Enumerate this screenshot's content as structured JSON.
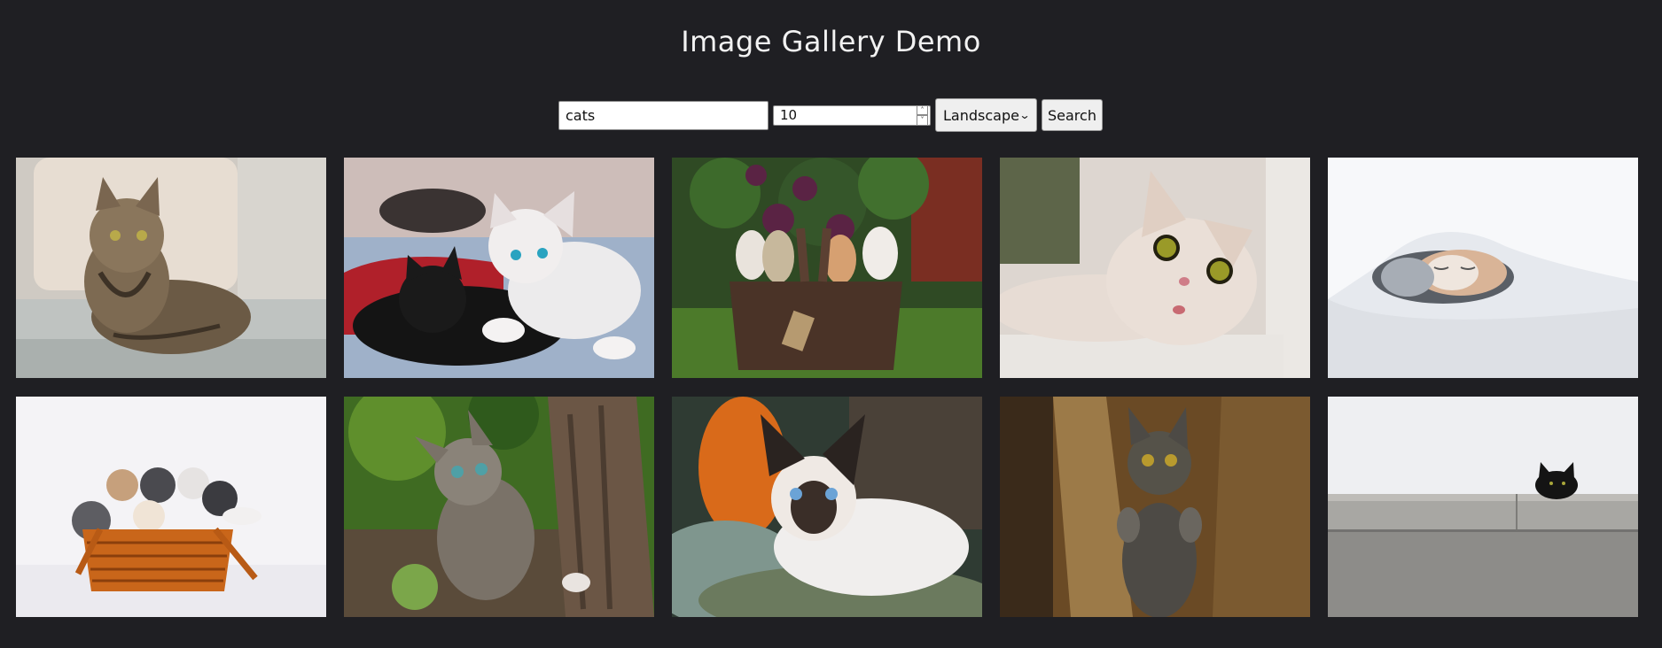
{
  "page": {
    "title": "Image Gallery Demo"
  },
  "controls": {
    "query": "cats",
    "count": "10",
    "orientation": "Landscape",
    "search_label": "Search"
  },
  "gallery": {
    "images": [
      {
        "subject": "tabby cat lying on sofa"
      },
      {
        "subject": "white and black kittens on blanket"
      },
      {
        "subject": "kittens in basket under lilac"
      },
      {
        "subject": "surprised cream cat"
      },
      {
        "subject": "cat sleeping under white duvet"
      },
      {
        "subject": "kittens in wicker basket"
      },
      {
        "subject": "tabby kitten by tree trunk"
      },
      {
        "subject": "siamese kitten on blanket"
      },
      {
        "subject": "gray cat standing up"
      },
      {
        "subject": "black cat peeking over wall"
      }
    ]
  }
}
